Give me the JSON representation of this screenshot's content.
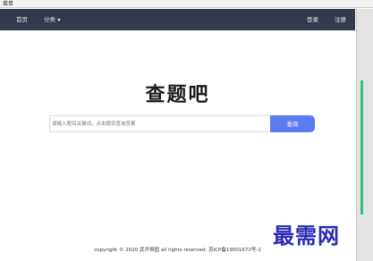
{
  "window": {
    "title": "菜单"
  },
  "navbar": {
    "home": "首页",
    "category": "分类",
    "login": "登录",
    "register": "注册"
  },
  "brand": {
    "logo_text": "查题吧"
  },
  "search": {
    "placeholder": "请输入题目关键词，点击题目查询答案",
    "button_label": "查询"
  },
  "footer": {
    "text": "copyright © 2020 武开恒园 all rights reserved. 苏ICP备19001672号-1"
  },
  "watermark": {
    "text": "最需网"
  },
  "colors": {
    "navbar": "#313b4d",
    "accent": "#5b7bf0"
  }
}
